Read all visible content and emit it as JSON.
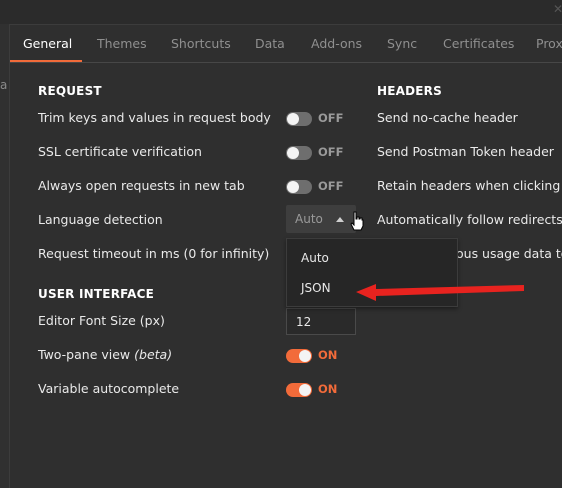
{
  "background": {
    "peek_text": "a"
  },
  "tabs": [
    {
      "label": "General",
      "active": true
    },
    {
      "label": "Themes"
    },
    {
      "label": "Shortcuts"
    },
    {
      "label": "Data"
    },
    {
      "label": "Add-ons"
    },
    {
      "label": "Sync"
    },
    {
      "label": "Certificates"
    },
    {
      "label": "Proxy"
    }
  ],
  "request": {
    "heading": "REQUEST",
    "trim": {
      "label": "Trim keys and values in request body",
      "state": "OFF"
    },
    "ssl": {
      "label": "SSL certificate verification",
      "state": "OFF"
    },
    "newtab": {
      "label": "Always open requests in new tab",
      "state": "OFF"
    },
    "language": {
      "label": "Language detection",
      "selected": "Auto",
      "options": [
        "Auto",
        "JSON"
      ]
    },
    "timeout": {
      "label": "Request timeout in ms (0 for infinity)"
    }
  },
  "ui": {
    "heading": "USER INTERFACE",
    "font_size": {
      "label": "Editor Font Size (px)",
      "value": "12"
    },
    "two_pane": {
      "label": "Two-pane view",
      "label_suffix": "(beta)",
      "state": "ON"
    },
    "autocomplete": {
      "label": "Variable autocomplete",
      "state": "ON"
    }
  },
  "headers": {
    "heading": "HEADERS",
    "nocache": "Send no-cache header",
    "token": "Send Postman Token header",
    "retain": "Retain headers when clicking on l",
    "redirects": "Automatically follow redirects",
    "usage": "ous usage data to P"
  },
  "colors": {
    "accent": "#f26b3a",
    "annotation_arrow": "#e8231f",
    "background": "#2f2f2f"
  }
}
